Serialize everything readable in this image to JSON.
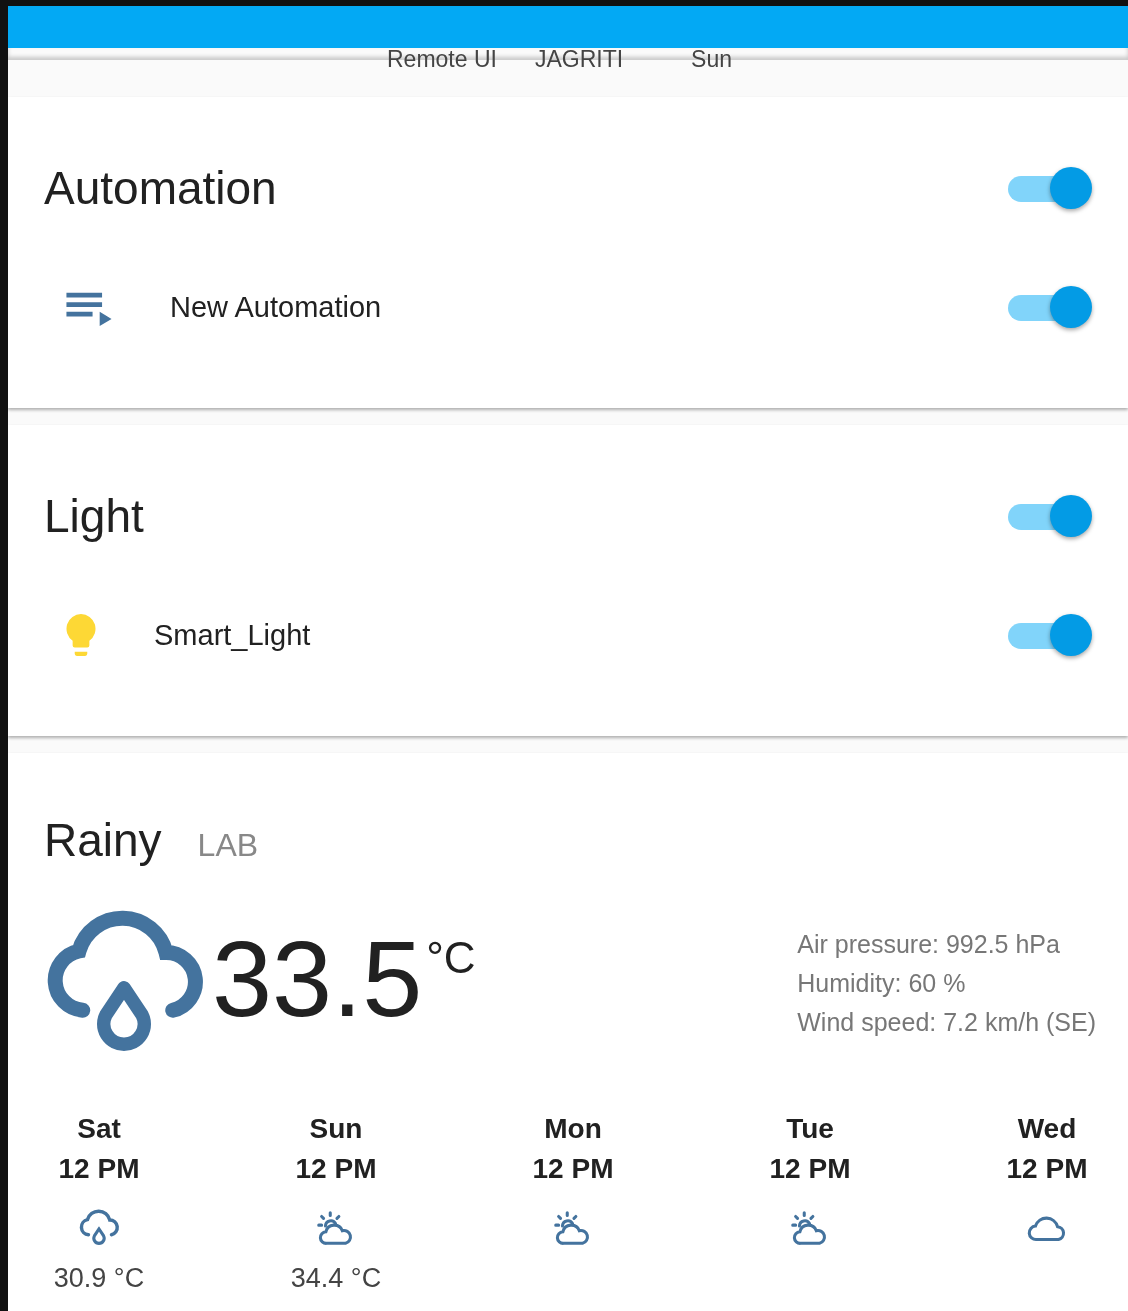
{
  "tabs": [
    {
      "label": "Remote UI"
    },
    {
      "label": "JAGRITI"
    },
    {
      "label": "Sun"
    }
  ],
  "cards": [
    {
      "title": "Automation",
      "on": true,
      "entities": [
        {
          "kind": "automation",
          "name": "New Automation",
          "on": true
        }
      ]
    },
    {
      "title": "Light",
      "on": true,
      "entities": [
        {
          "kind": "light",
          "name": "Smart_Light",
          "on": true
        }
      ]
    }
  ],
  "weather": {
    "kind": "rainy",
    "title": "Rainy",
    "location": "LAB",
    "temperature": "33.5",
    "unit": "°C",
    "attributes": [
      "Air pressure: 992.5 hPa",
      "Humidity: 60 %",
      "Wind speed: 7.2 km/h (SE)"
    ],
    "forecast": [
      {
        "day": "Sat",
        "time": "12 PM",
        "kind": "rainy",
        "temp": "30.9 °C"
      },
      {
        "day": "Sun",
        "time": "12 PM",
        "kind": "partlycloudy",
        "temp": "34.4 °C"
      },
      {
        "day": "Mon",
        "time": "12 PM",
        "kind": "partlycloudy"
      },
      {
        "day": "Tue",
        "time": "12 PM",
        "kind": "partlycloudy"
      },
      {
        "day": "Wed",
        "time": "12 PM",
        "kind": "cloudy"
      }
    ]
  }
}
